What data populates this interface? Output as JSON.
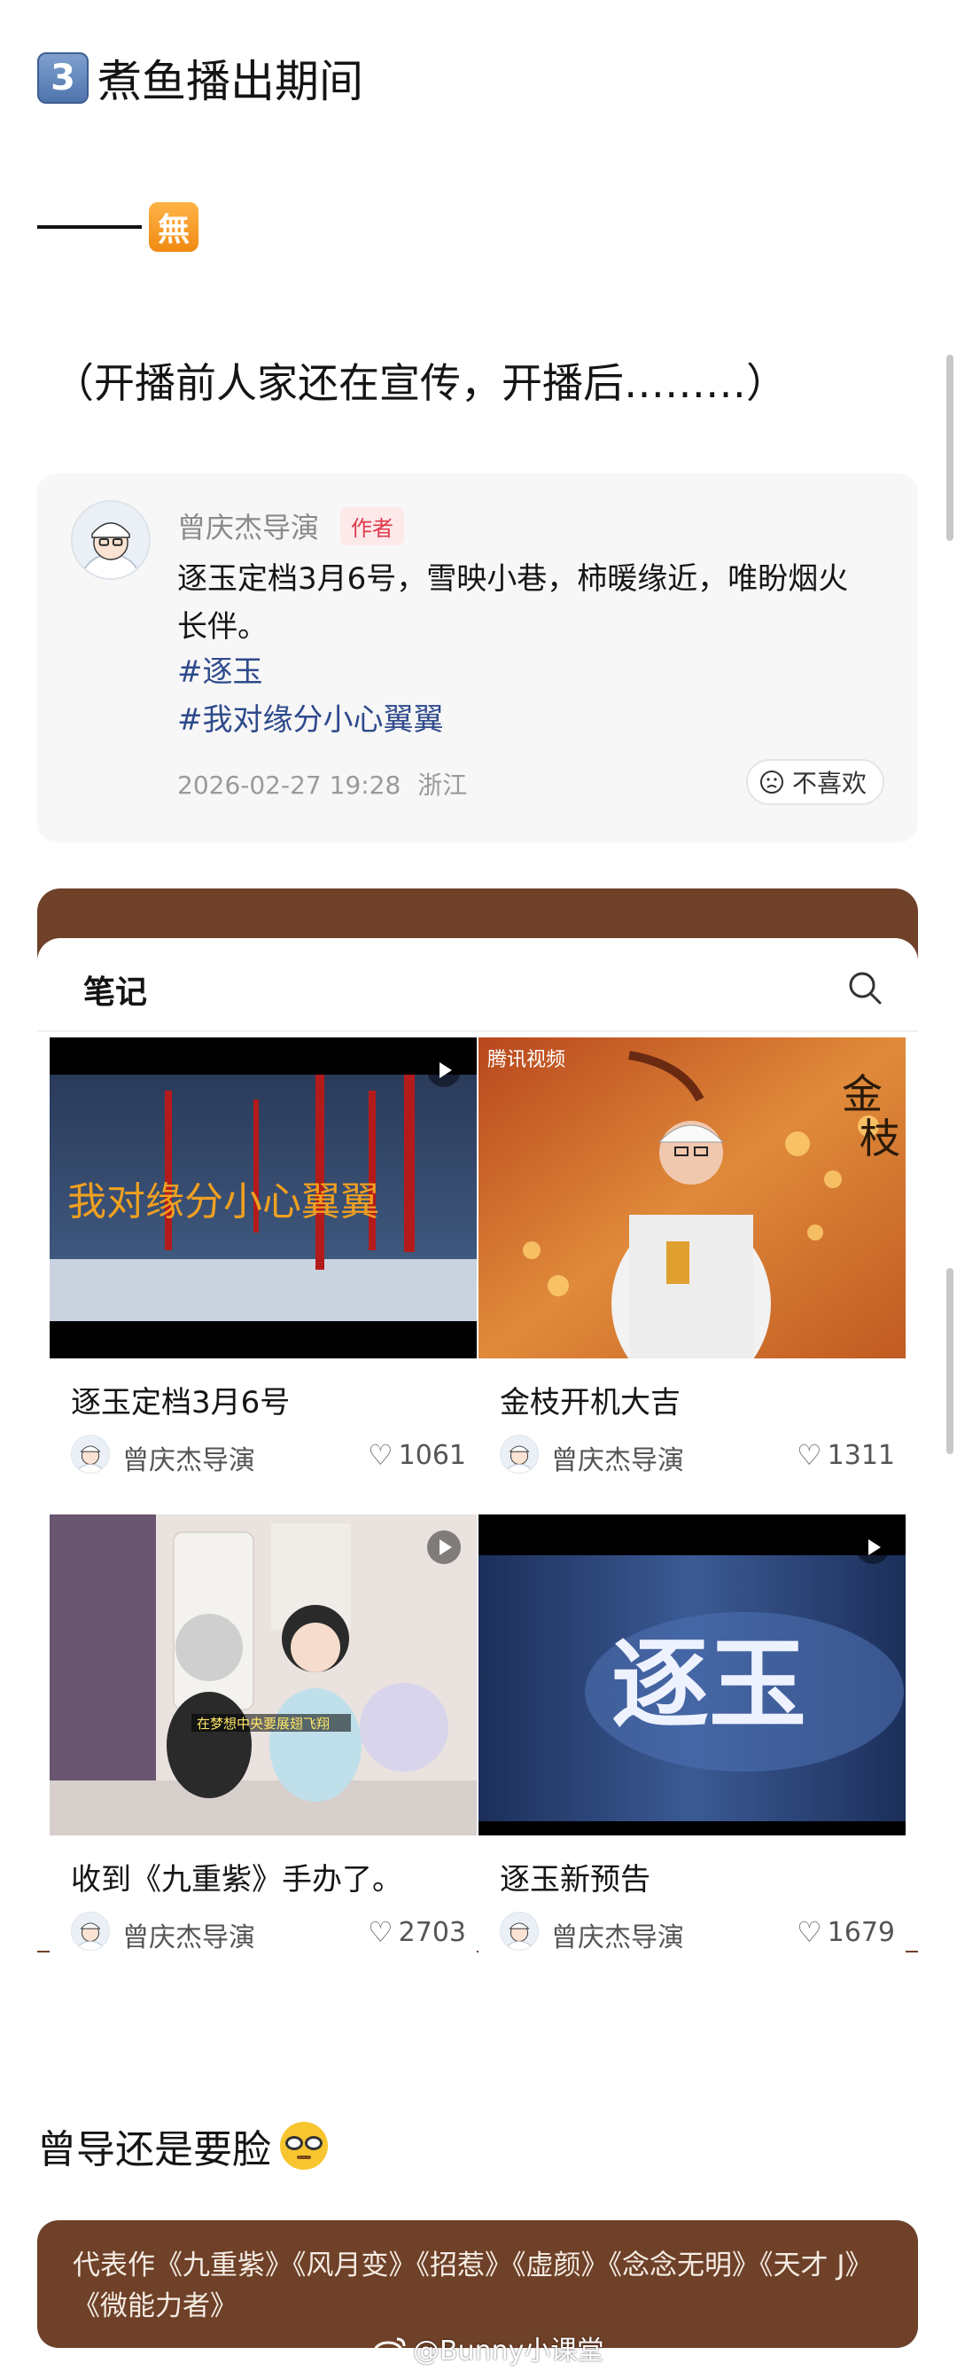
{
  "heading": {
    "badge": "3",
    "title": "煮鱼播出期间"
  },
  "marker": {
    "char": "無"
  },
  "paragraph": "（开播前人家还在宣传，开播后………）",
  "post": {
    "author": "曾庆杰导演",
    "author_tag": "作者",
    "line1": "逐玉定档3月6号，雪映小巷，柿暖缘近，唯盼烟火",
    "line2": "长伴。",
    "hashtags": [
      "#逐玉",
      "#我对缘分小心翼翼"
    ],
    "datetime": "2026-02-27 19:28",
    "location": "浙江",
    "dislike_label": "不喜欢"
  },
  "notes": {
    "title": "笔记",
    "items": [
      {
        "title": "逐玉定档3月6号",
        "author": "曾庆杰导演",
        "likes": "1061",
        "has_video": true,
        "thumb_text": "我对缘分小心翼翼"
      },
      {
        "title": "金枝开机大吉",
        "author": "曾庆杰导演",
        "likes": "1311",
        "has_video": false,
        "thumb_text": "腾讯视频"
      },
      {
        "title": "收到《九重紫》手办了。",
        "author": "曾庆杰导演",
        "likes": "2703",
        "has_video": true,
        "thumb_text": "在梦想中央要展翅飞翔"
      },
      {
        "title": "逐玉新预告",
        "author": "曾庆杰导演",
        "likes": "1679",
        "has_video": true,
        "thumb_text": "逐玉"
      }
    ]
  },
  "closing": "曾导还是要脸",
  "works": "代表作《九重紫》《风月变》《招惹》《虚颜》《念念无明》《天才 J》《微能力者》",
  "watermark": "@Bunny小课堂",
  "colors": {
    "brown_frame": "#6e4128",
    "hashtag": "#2f4a8c",
    "author_tag": "#e0394b"
  }
}
